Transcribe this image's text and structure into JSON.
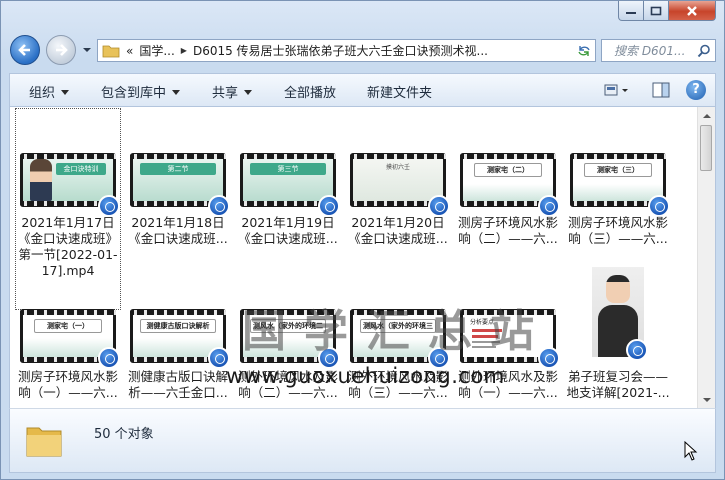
{
  "address": {
    "overflow": "«",
    "segments": [
      "国学...",
      "D6015 传易居士张瑞依弟子班大六壬金口诀预测术视..."
    ]
  },
  "search": {
    "placeholder": "搜索 D601..."
  },
  "toolbar": {
    "organize": "组织",
    "include_in_library": "包含到库中",
    "share": "共享",
    "play_all": "全部播放",
    "new_folder": "新建文件夹",
    "help": "?"
  },
  "files": [
    {
      "name": "2021年1月17日《金口诀速成班》第一节[2022-01-17].mp4",
      "thumb_label": "金口诀特训",
      "selected": true
    },
    {
      "name": "2021年1月18日《金口诀速成班...",
      "thumb_label": "第二节"
    },
    {
      "name": "2021年1月19日《金口诀速成班...",
      "thumb_label": "第三节"
    },
    {
      "name": "2021年1月20日《金口诀速成班...",
      "thumb_label": "摸初六壬"
    },
    {
      "name": "测房子环境风水影响（二）——六...",
      "thumb_label": "测家宅（二）"
    },
    {
      "name": "测房子环境风水影响（三）——六...",
      "thumb_label": "测家宅（三）"
    },
    {
      "name": "测房子环境风水影响（一）——六...",
      "thumb_label": "测家宅（一）"
    },
    {
      "name": "测健康古版口诀解析——六壬金口...",
      "thumb_label": "测健康古版口诀解析"
    },
    {
      "name": "测外环境风水及影响（二）——六...",
      "thumb_label": "测风水（家外的环境二"
    },
    {
      "name": "测外环境风水及影响（三）——六...",
      "thumb_label": "测风水（家外的环境三"
    },
    {
      "name": "测外环境风水及影响（一）——六...",
      "thumb_label": "分析要点"
    },
    {
      "name": "弟子班复习会——地支详解[2021-..."
    }
  ],
  "watermark": {
    "text": "国学汇总站",
    "url": "www.guoxuehuizong.com"
  },
  "status": {
    "count": "50 个对象"
  },
  "colors": {
    "accent": "#1a56b6",
    "thumb_green": "#3ea88a",
    "window": "#c9dbef"
  }
}
